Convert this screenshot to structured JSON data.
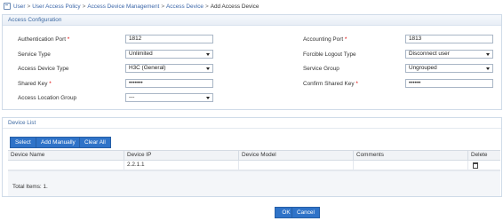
{
  "breadcrumb": {
    "items": [
      "User",
      "User Access Policy",
      "Access Device Management",
      "Access Device"
    ],
    "separator": ">",
    "current": "Add Access Device"
  },
  "access_config": {
    "title": "Access Configuration",
    "auth_port": {
      "label": "Authentication Port",
      "value": "1812"
    },
    "accounting_port": {
      "label": "Accounting Port",
      "value": "1813"
    },
    "service_type": {
      "label": "Service Type",
      "value": "Unlimited"
    },
    "forcible_logout": {
      "label": "Forcible Logout Type",
      "value": "Disconnect user"
    },
    "device_type": {
      "label": "Access Device Type",
      "value": "H3C (General)"
    },
    "service_group": {
      "label": "Service Group",
      "value": "Ungrouped"
    },
    "shared_key": {
      "label": "Shared Key",
      "value": "•••••••"
    },
    "confirm_key": {
      "label": "Confirm Shared Key",
      "value": "••••••"
    },
    "location_group": {
      "label": "Access Location Group",
      "value": "---"
    },
    "required_mark": "*"
  },
  "device_list": {
    "title": "Device List",
    "buttons": {
      "select": "Select",
      "add_manually": "Add Manually",
      "clear_all": "Clear All"
    },
    "columns": [
      "Device Name",
      "Device IP",
      "Device Model",
      "Comments",
      "Delete"
    ],
    "rows": [
      {
        "name": "",
        "ip": "2.2.1.1",
        "model": "",
        "comments": "",
        "delete_icon": "trash-icon"
      }
    ],
    "total": "Total Items: 1."
  },
  "footer": {
    "ok": "OK",
    "cancel": "Cancel"
  },
  "colors": {
    "accent": "#2f73c8",
    "panel_title": "#3e6aa3",
    "link": "#3b66a8"
  }
}
